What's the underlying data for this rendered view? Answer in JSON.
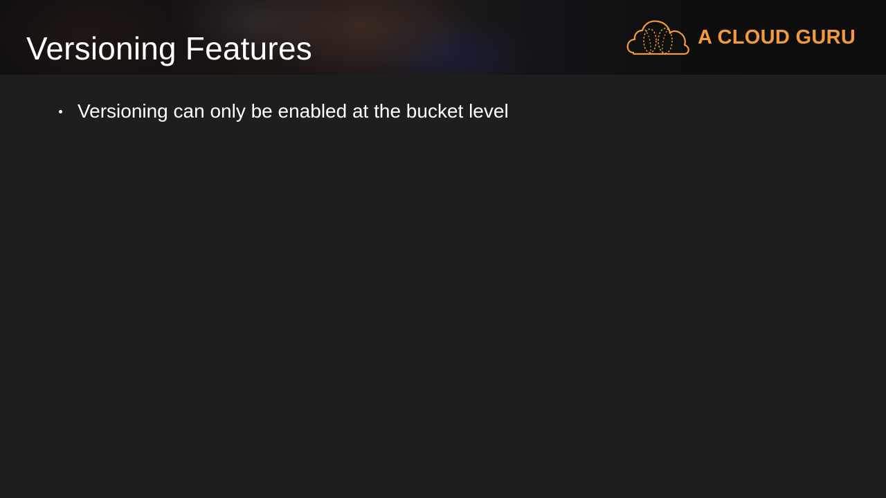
{
  "slide": {
    "title": "Versioning Features",
    "bullets": [
      "Versioning can only be enabled at the bucket level"
    ]
  },
  "brand": {
    "name": "A CLOUD GURU",
    "icon": "cloud-logo-icon",
    "accent_color": "#f39a3a"
  },
  "colors": {
    "background": "#1e1e1e",
    "text": "#ffffff"
  }
}
